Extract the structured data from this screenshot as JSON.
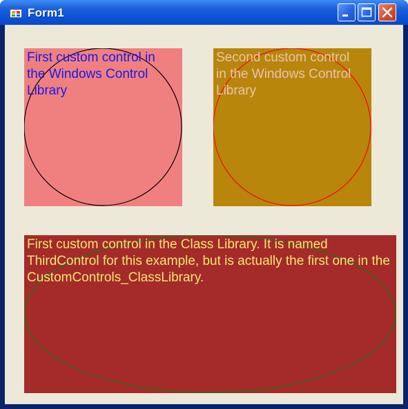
{
  "window": {
    "title": "Form1",
    "icon": "winforms-app-icon",
    "controls": {
      "minimize": "minimize-icon",
      "maximize": "maximize-icon",
      "close": "close-icon"
    }
  },
  "controls": {
    "first": {
      "text": "First custom control in the Windows Control Library",
      "background": "#f08080",
      "text_color": "#1818e8",
      "shape_color": "#000000",
      "shape": "circle"
    },
    "second": {
      "text": "Second custom control in the Windows Control Library",
      "background": "#b8860b",
      "text_color": "#e8c4b0",
      "shape_color": "#ff0000",
      "shape": "circle"
    },
    "third": {
      "text": "First custom control in the Class Library. It is named ThirdControl for this example, but is actually the first one in the CustomControls_ClassLibrary.",
      "background": "#a52a2a",
      "text_color": "#f0e870",
      "shape_color": "#2e6b1a",
      "shape": "ellipse"
    }
  }
}
